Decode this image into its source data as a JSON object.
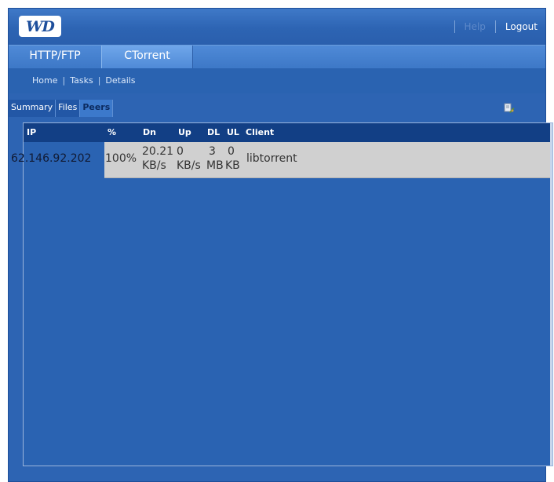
{
  "header": {
    "logo": "WD",
    "help": "Help",
    "logout": "Logout"
  },
  "tabs": [
    {
      "label": "HTTP/FTP"
    },
    {
      "label": "CTorrent",
      "active": true
    }
  ],
  "breadcrumb": [
    "Home",
    "Tasks",
    "Details"
  ],
  "subtabs": [
    {
      "label": "Summary"
    },
    {
      "label": "Files"
    },
    {
      "label": "Peers",
      "active": true
    }
  ],
  "table": {
    "columns": [
      "IP",
      "%",
      "Dn",
      "Up",
      "DL",
      "UL",
      "Client"
    ],
    "rows": [
      {
        "ip": "62.146.92.202",
        "pct": "100%",
        "dn_value": "20.21",
        "dn_unit": "KB/s",
        "up_value": "0",
        "up_unit": "KB/s",
        "dl_value": "3",
        "dl_unit": "MB",
        "ul_value": "0",
        "ul_unit": "KB",
        "client": "libtorrent"
      }
    ]
  },
  "colors": {
    "background": "#2d64b3",
    "header_row": "#123f85",
    "row_fill": "#d0d0d0"
  },
  "icons": {
    "settings": "tools-settings-icon"
  }
}
